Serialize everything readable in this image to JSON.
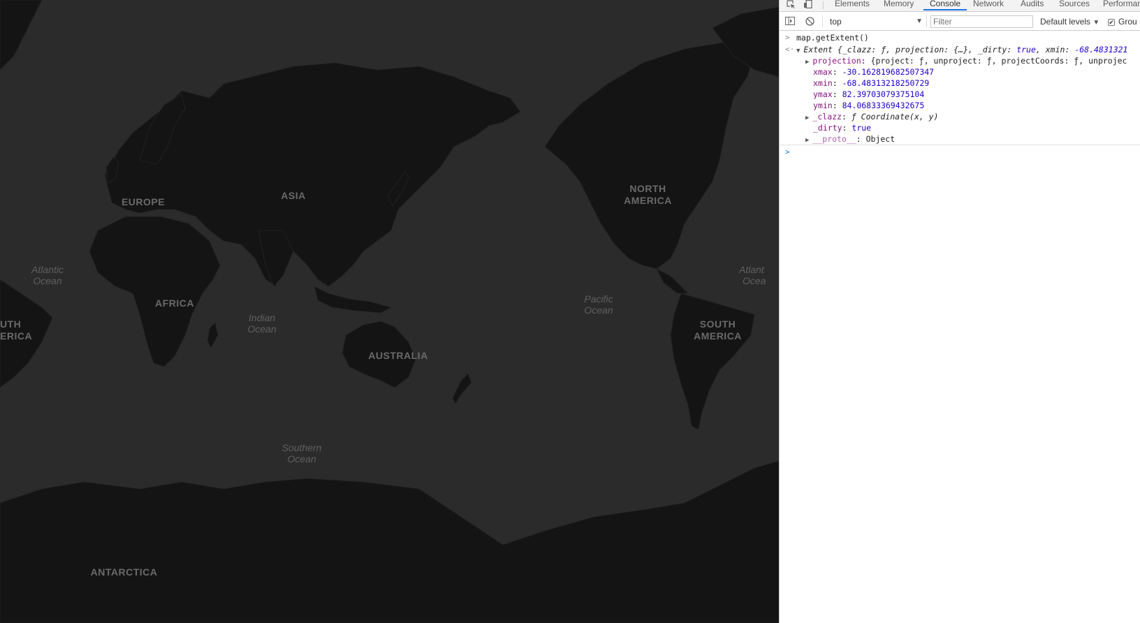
{
  "map": {
    "labels": {
      "europe": "EUROPE",
      "asia": "ASIA",
      "north_america_1": "NORTH",
      "north_america_2": "AMERICA",
      "africa": "AFRICA",
      "australia": "AUSTRALIA",
      "south_america_right_1": "SOUTH",
      "south_america_right_2": "AMERICA",
      "south_america_left_1": "UTH",
      "south_america_left_2": "ERICA",
      "antarctica": "ANTARCTICA",
      "atlantic_left_1": "Atlantic",
      "atlantic_left_2": "Ocean",
      "atlantic_right_1": "Atlant",
      "atlantic_right_2": "Ocea",
      "indian_1": "Indian",
      "indian_2": "Ocean",
      "pacific_1": "Pacific",
      "pacific_2": "Ocean",
      "southern_1": "Southern",
      "southern_2": "Ocean"
    },
    "colors": {
      "water": "#2b2b2b",
      "land": "#141414",
      "label": "#6a6a6a"
    }
  },
  "devtools": {
    "tabs": [
      "Elements",
      "Memory",
      "Console",
      "Network",
      "Audits",
      "Sources",
      "Performan"
    ],
    "active_tab": "Console",
    "toolbar": {
      "context": "top",
      "filter_placeholder": "Filter",
      "levels": "Default levels",
      "group_label": "Grou"
    },
    "console": {
      "input": "map.getExtent()",
      "result_head": {
        "name": "Extent",
        "preview_open": " {",
        "clazz_key": "_clazz",
        "clazz_val": "ƒ",
        "proj_key": "projection",
        "proj_val": "{…}",
        "dirty_key": "_dirty",
        "dirty_val": "true",
        "xmin_key": "xmin",
        "xmin_val": "-68.4831321"
      },
      "projection": {
        "key": "projection",
        "value": "{project: ƒ, unproject: ƒ, projectCoords: ƒ, unprojec"
      },
      "xmax": {
        "key": "xmax",
        "value": "-30.162819682507347"
      },
      "xmin": {
        "key": "xmin",
        "value": "-68.48313218250729"
      },
      "ymax": {
        "key": "ymax",
        "value": "82.39703079375104"
      },
      "ymin": {
        "key": "ymin",
        "value": "84.06833369432675"
      },
      "clazz": {
        "key": "_clazz",
        "value": "ƒ Coordinate(x, y)"
      },
      "dirty": {
        "key": "_dirty",
        "value": "true"
      },
      "proto": {
        "key": "__proto__",
        "value": "Object"
      }
    }
  }
}
